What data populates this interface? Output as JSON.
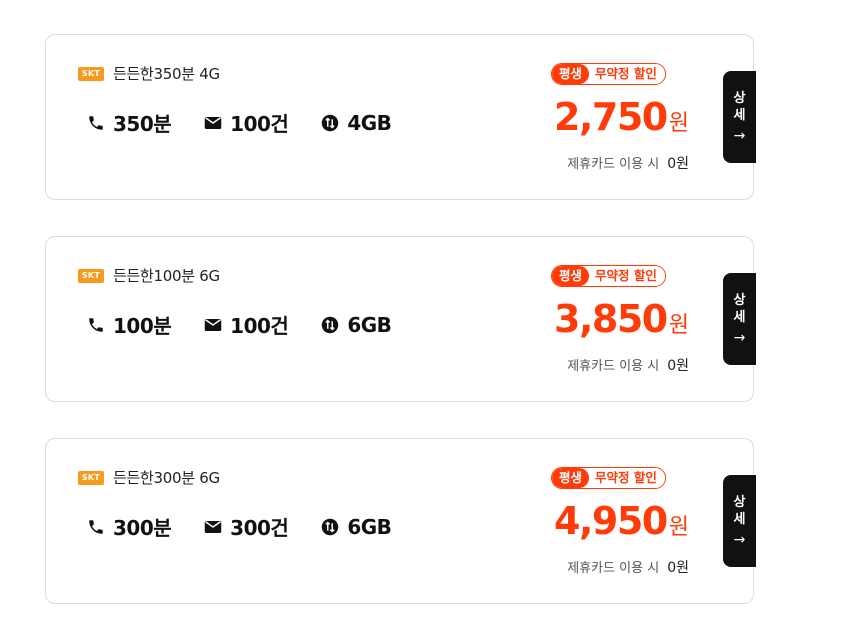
{
  "plans": [
    {
      "carrier": "SKT",
      "name": "든든한350분 4G",
      "calls": "350분",
      "sms": "100건",
      "data": "4GB",
      "promo_tag": "평생",
      "promo_text": "무약정 할인",
      "price": "2,750",
      "price_unit": "원",
      "card_note": "제휴카드 이용 시",
      "card_price": "0원",
      "detail_label_1": "상",
      "detail_label_2": "세",
      "detail_arrow": "→"
    },
    {
      "carrier": "SKT",
      "name": "든든한100분 6G",
      "calls": "100분",
      "sms": "100건",
      "data": "6GB",
      "promo_tag": "평생",
      "promo_text": "무약정 할인",
      "price": "3,850",
      "price_unit": "원",
      "card_note": "제휴카드 이용 시",
      "card_price": "0원",
      "detail_label_1": "상",
      "detail_label_2": "세",
      "detail_arrow": "→"
    },
    {
      "carrier": "SKT",
      "name": "든든한300분 6G",
      "calls": "300분",
      "sms": "300건",
      "data": "6GB",
      "promo_tag": "평생",
      "promo_text": "무약정 할인",
      "price": "4,950",
      "price_unit": "원",
      "card_note": "제휴카드 이용 시",
      "card_price": "0원",
      "detail_label_1": "상",
      "detail_label_2": "세",
      "detail_arrow": "→"
    }
  ],
  "icons": {
    "call": "phone-icon",
    "sms": "envelope-icon",
    "data": "data-arrows-icon"
  },
  "colors": {
    "accent": "#ff3b0a",
    "carrier_badge": "#f79a1e",
    "detail_button": "#111111"
  }
}
